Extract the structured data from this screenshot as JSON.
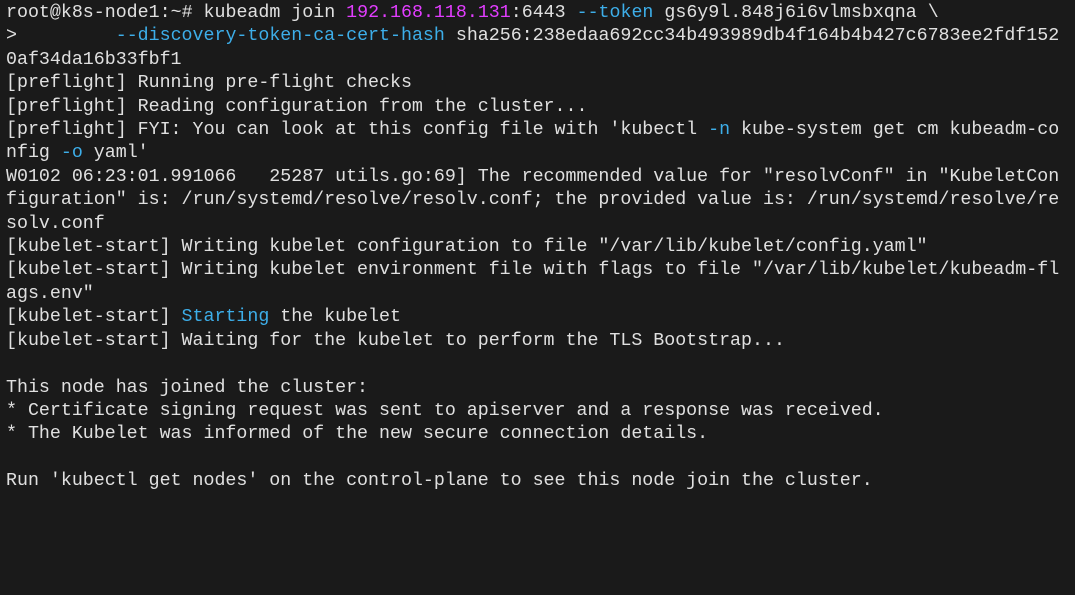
{
  "terminal": {
    "prompt_user_host": "root@k8s-node1",
    "prompt_path": "~",
    "prompt_symbol": "#",
    "command": "kubeadm join",
    "ip": "192.168.118.131",
    "port": "6443",
    "flag_token": "--token",
    "token_value": "gs6y9l.848j6i6vlmsbxqna",
    "backslash": "\\",
    "continuation_prompt": ">",
    "flag_discovery": "--discovery-token-ca-cert-hash",
    "hash_value": "sha256:238edaa692cc34b493989db4f164b4b427c6783ee2fdf1520af34da16b33fbf1",
    "lines": {
      "preflight1": "[preflight] Running pre-flight checks",
      "preflight2": "[preflight] Reading configuration from the cluster...",
      "preflight3a": "[preflight] FYI: You can look at this config file with 'kubectl ",
      "preflight3_flag_n": "-n",
      "preflight3b": " kube-system get cm kubeadm-config ",
      "preflight3_flag_o": "-o",
      "preflight3c": " yaml'",
      "warn": "W0102 06:23:01.991066   25287 utils.go:69] The recommended value for \"resolvConf\" in \"KubeletConfiguration\" is: /run/systemd/resolve/resolv.conf; the provided value is: /run/systemd/resolve/resolv.conf",
      "ks1": "[kubelet-start] Writing kubelet configuration to file \"/var/lib/kubelet/config.yaml\"",
      "ks2": "[kubelet-start] Writing kubelet environment file with flags to file \"/var/lib/kubelet/kubeadm-flags.env\"",
      "ks3a": "[kubelet-start] ",
      "ks3_starting": "Starting",
      "ks3b": " the kubelet",
      "ks4": "[kubelet-start] Waiting for the kubelet to perform the TLS Bootstrap...",
      "blank": "",
      "joined_header": "This node has joined the cluster:",
      "joined1": "* Certificate signing request was sent to apiserver and a response was received.",
      "joined2": "* The Kubelet was informed of the new secure connection details.",
      "run_hint": "Run 'kubectl get nodes' on the control-plane to see this node join the cluster."
    }
  }
}
